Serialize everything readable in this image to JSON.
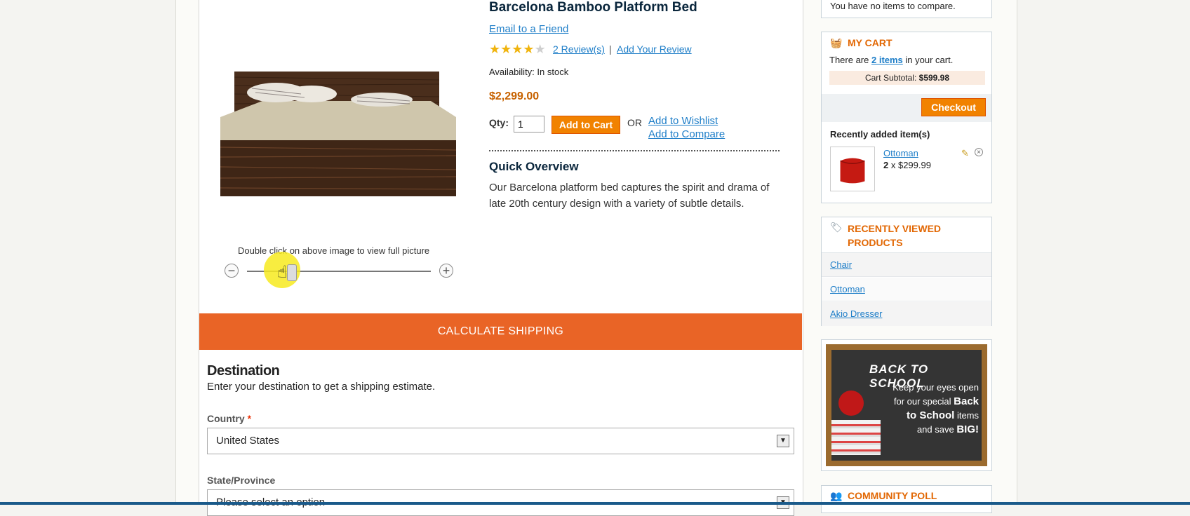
{
  "product": {
    "name": "Barcelona Bamboo Platform Bed",
    "email_friend": "Email to a Friend",
    "rating_stars_filled": 4,
    "rating_stars_total": 5,
    "reviews_link": "2 Review(s)",
    "separator": "|",
    "add_review": "Add Your Review",
    "availability": "Availability: In stock",
    "price": "$2,299.00",
    "qty_label": "Qty:",
    "qty_value": "1",
    "add_to_cart": "Add to Cart",
    "or_label": "OR",
    "add_to_wishlist": "Add to Wishlist",
    "add_to_compare": "Add to Compare",
    "quick_overview_title": "Quick Overview",
    "quick_overview_text": "Our Barcelona platform bed captures the spirit and drama of late 20th century design with a variety of subtle details.",
    "image_caption": "Double click on above image to view full picture",
    "zoom_out": "−",
    "zoom_in": "+"
  },
  "shipping": {
    "header": "CALCULATE SHIPPING",
    "destination_title": "Destination",
    "destination_desc": "Enter your destination to get a shipping estimate.",
    "country_label": "Country",
    "required_mark": "*",
    "country_value": "United States",
    "state_label": "State/Province",
    "state_placeholder": "Please select an option"
  },
  "sidebar": {
    "compare_msg": "You have no items to compare.",
    "cart": {
      "title": "MY CART",
      "text_before": "There are ",
      "items_link": "2 items",
      "text_after": " in your cart.",
      "subtotal_label": "Cart Subtotal:",
      "subtotal_value": "$599.98",
      "checkout": "Checkout",
      "recent_title": "Recently added item(s)",
      "item_name": "Ottoman",
      "item_qty": "2",
      "item_price": " x $299.99"
    },
    "recently_viewed": {
      "title_line1": "RECENTLY VIEWED",
      "title_line2": "PRODUCTS",
      "items": [
        "Chair",
        "Ottoman",
        "Akio Dresser"
      ]
    },
    "promo": {
      "title": "BACK TO SCHOOL",
      "line1": "Keep your eyes open",
      "line2": "for our special ",
      "bold1": "Back",
      "bold2": "to School",
      "line3": " items",
      "line4": "and save ",
      "bold3": "BIG!"
    },
    "poll_title": "COMMUNITY POLL"
  },
  "colors": {
    "accent_orange": "#f18200",
    "shipping_header": "#e96426",
    "link": "#1e7ec8",
    "block_title": "#e26703"
  }
}
